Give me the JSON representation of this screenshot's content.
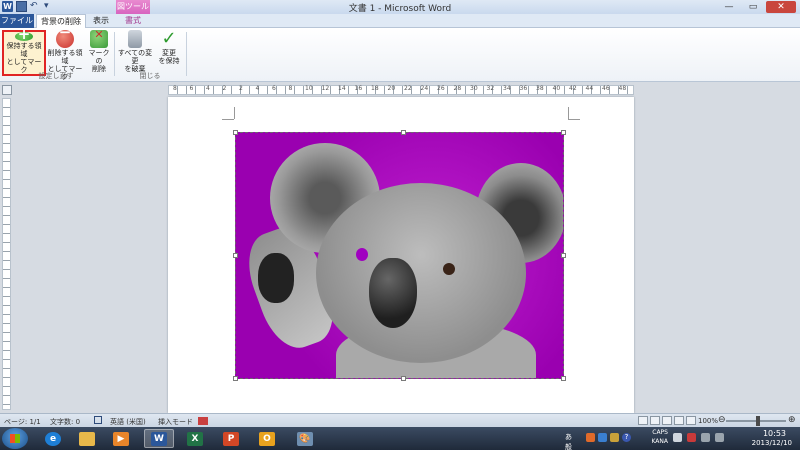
{
  "title": {
    "text": "文書 1 - Microsoft Word",
    "contextual_group": "図ツール"
  },
  "tabs": {
    "file": "ファイル",
    "bg_remove": "背景の削除",
    "view": "表示",
    "format": "書式"
  },
  "ribbon": {
    "keep_line1": "保持する領域",
    "keep_line2": "としてマーク",
    "remove_line1": "削除する領域",
    "remove_line2": "としてマーク",
    "delmark_line1": "マークの",
    "delmark_line2": "削除",
    "discard_line1": "すべての変更",
    "discard_line2": "を破棄",
    "keepchg_line1": "変更",
    "keepchg_line2": "を保持",
    "group_refine": "設定し直す",
    "group_close": "閉じる"
  },
  "ruler": {
    "labels": [
      "8",
      "6",
      "4",
      "2",
      "2",
      "4",
      "6",
      "8",
      "10",
      "12",
      "14",
      "16",
      "18",
      "20",
      "22",
      "24",
      "26",
      "28",
      "30",
      "32",
      "34",
      "36",
      "38",
      "40",
      "42",
      "44",
      "46",
      "48"
    ]
  },
  "status": {
    "page": "ページ: 1/1",
    "words": "文字数: 0",
    "language": "英語 (米国)",
    "mode": "挿入モード",
    "zoom": "100%"
  },
  "taskbar": {
    "time": "10:53",
    "date": "2013/12/10",
    "ime": "あ 般",
    "caps": "CAPS",
    "kana": "KANA"
  },
  "colors": {
    "word_blue": "#2b579a",
    "keep_highlight": "#e02424",
    "removal_overlay": "#b010c8",
    "contextual_tab": "#d764bf"
  }
}
